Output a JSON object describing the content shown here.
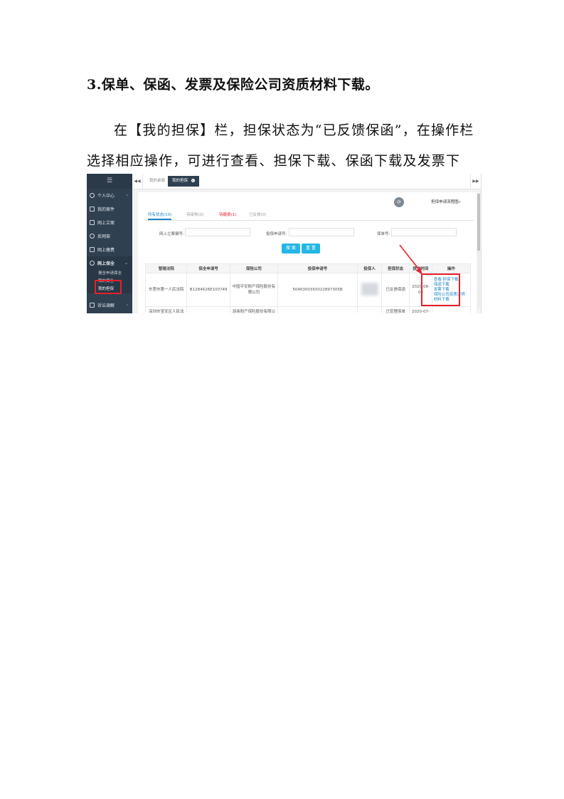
{
  "document": {
    "heading": "3.保单、保函、发票及保险公司资质材料下载。",
    "paragraph": "在【我的担保】栏，担保状态为“已反馈保函”，在操作栏选择相应操作，可进行查看、担保下载、保函下载及发票下载。"
  },
  "screenshot": {
    "sidebar": {
      "toggle": "☰",
      "items": [
        {
          "label": "个人中心"
        },
        {
          "label": "我的案件"
        },
        {
          "label": "网上立案"
        },
        {
          "label": "反网架"
        },
        {
          "label": "网上缴费"
        },
        {
          "label": "网上保全"
        }
      ],
      "sub_items": [
        "报全申请保全",
        "我的保全",
        "我的担保"
      ],
      "bottom_item": "诉讼调解"
    },
    "topbar": {
      "nav_left": "◀◀",
      "nav_right": "▶▶",
      "tabs": [
        {
          "label": "我的桌面"
        },
        {
          "label": "我的担保"
        }
      ]
    },
    "panel": {
      "refresh_icon": "⟳",
      "flow_link": "担保申请流程图»",
      "status_tabs": [
        {
          "label": "所有状态(10)",
          "color": "#1c84c6"
        },
        {
          "label": "待审核(0)",
          "color": "#999999"
        },
        {
          "label": "待缴费(1)",
          "color": "#e8202a"
        },
        {
          "label": "已反馈(0)",
          "color": "#999999"
        }
      ],
      "filters": {
        "case_no_label": "网上立案编号:",
        "apply_no_label": "投保申请号:",
        "policy_no_label": "保单号:"
      },
      "buttons": {
        "search": "搜 索",
        "reset": "重 置"
      },
      "columns": [
        "管辖法院",
        "保全申请号",
        "保险公司",
        "投保申请号",
        "投保人",
        "担保状态",
        "提交时间",
        "操作"
      ],
      "rows": [
        {
          "court": "东莞市第一人民法院",
          "preserve_no": "B1284626E100749",
          "insurer": "中国平安财产保险股份有限公司",
          "apply_no": "5046300350022897305B",
          "applicant": "",
          "status": "已反馈保函",
          "time": "2020-08-05",
          "ops": [
            "查看",
            "担保下载",
            "保函下载",
            "发票下载",
            "保险公司资质证明",
            "材料下载"
          ]
        },
        {
          "court": "深圳市宝安区人民法院",
          "preserve_no": "",
          "insurer": "浙商财产保险股份有限公司",
          "apply_no": "",
          "applicant": "",
          "status": "已受理保单",
          "time": "2020-07-",
          "ops": []
        }
      ]
    },
    "accent_colors": {
      "sidebar_bg": "#2f4050",
      "link_blue": "#1c84c6",
      "highlight_red": "#e8202a",
      "btn_green": "#1ab394"
    }
  }
}
